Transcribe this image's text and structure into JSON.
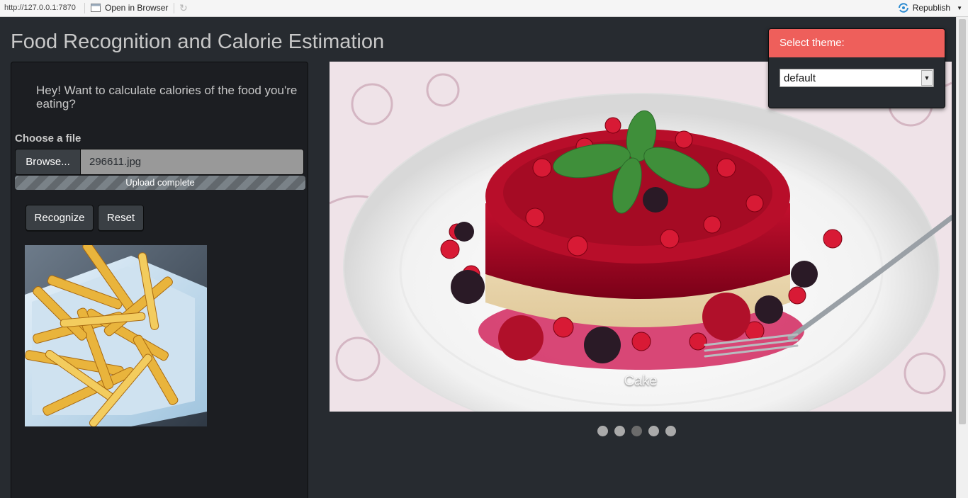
{
  "toolbar": {
    "url": "http://127.0.0.1:7870",
    "open_in_browser": "Open in Browser",
    "republish": "Republish"
  },
  "app": {
    "title": "Food Recognition and Calorie Estimation",
    "greeting": "Hey! Want to calculate calories of the food you're eating?",
    "file_input": {
      "label": "Choose a file",
      "browse_label": "Browse...",
      "file_name": "296611.jpg",
      "progress_text": "Upload complete",
      "progress": 1.0
    },
    "buttons": {
      "recognize": "Recognize",
      "reset": "Reset"
    },
    "carousel": {
      "caption": "Cake",
      "slide_count": 5,
      "active_index": 2
    },
    "theme": {
      "header": "Select theme:",
      "selected": "default"
    }
  },
  "colors": {
    "background": "#272b30",
    "sidebar": "#1c1e22",
    "accent": "#ee5f5b"
  }
}
